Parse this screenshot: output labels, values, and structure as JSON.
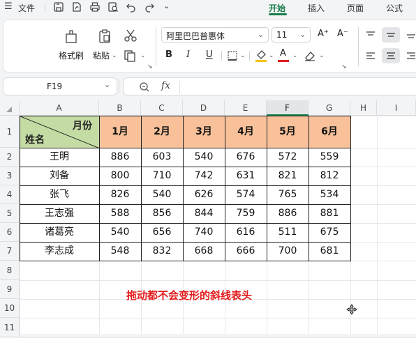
{
  "menu": {
    "file_label": "文件",
    "tabs": [
      {
        "label": "开始",
        "active": true
      },
      {
        "label": "插入",
        "active": false
      },
      {
        "label": "页面",
        "active": false
      },
      {
        "label": "公式",
        "active": false
      }
    ]
  },
  "ribbon": {
    "format_painter_label": "格式刷",
    "paste_label": "粘贴",
    "font_name": "阿里巴巴普惠体",
    "font_size": "11",
    "bold": "B",
    "italic": "I",
    "underline": "U",
    "font_color_glyph": "A",
    "grow_font_glyph": "A⁺",
    "shrink_font_glyph": "A⁻",
    "accent_color": "#e02020"
  },
  "formula_bar": {
    "cell_ref": "F19",
    "fx_label": "fx",
    "content": ""
  },
  "sheet": {
    "columns": [
      "A",
      "B",
      "C",
      "D",
      "E",
      "F",
      "G",
      "H",
      "I"
    ],
    "selected_column": "F",
    "rows": [
      "1",
      "2",
      "3",
      "4",
      "5",
      "6",
      "7",
      "8",
      "9",
      "10",
      "11"
    ],
    "header_fill": "#f8c19a",
    "name_header_fill": "#c5dba4",
    "diag_header": {
      "top_right": "月份",
      "bottom_left": "姓名"
    },
    "month_headers": [
      "1月",
      "2月",
      "3月",
      "4月",
      "5月",
      "6月"
    ],
    "table_rows": [
      {
        "name": "王明",
        "values": [
          "886",
          "603",
          "540",
          "676",
          "572",
          "559"
        ]
      },
      {
        "name": "刘备",
        "values": [
          "800",
          "710",
          "742",
          "631",
          "821",
          "812"
        ]
      },
      {
        "name": "张飞",
        "values": [
          "826",
          "540",
          "626",
          "574",
          "765",
          "534"
        ]
      },
      {
        "name": "王志强",
        "values": [
          "588",
          "856",
          "844",
          "759",
          "886",
          "881"
        ]
      },
      {
        "name": "诸葛亮",
        "values": [
          "540",
          "656",
          "740",
          "616",
          "511",
          "675"
        ]
      },
      {
        "name": "李志成",
        "values": [
          "548",
          "832",
          "668",
          "666",
          "700",
          "681"
        ]
      }
    ],
    "caption": "拖动都不会变形的斜线表头",
    "caption_color": "#e31b1b"
  }
}
